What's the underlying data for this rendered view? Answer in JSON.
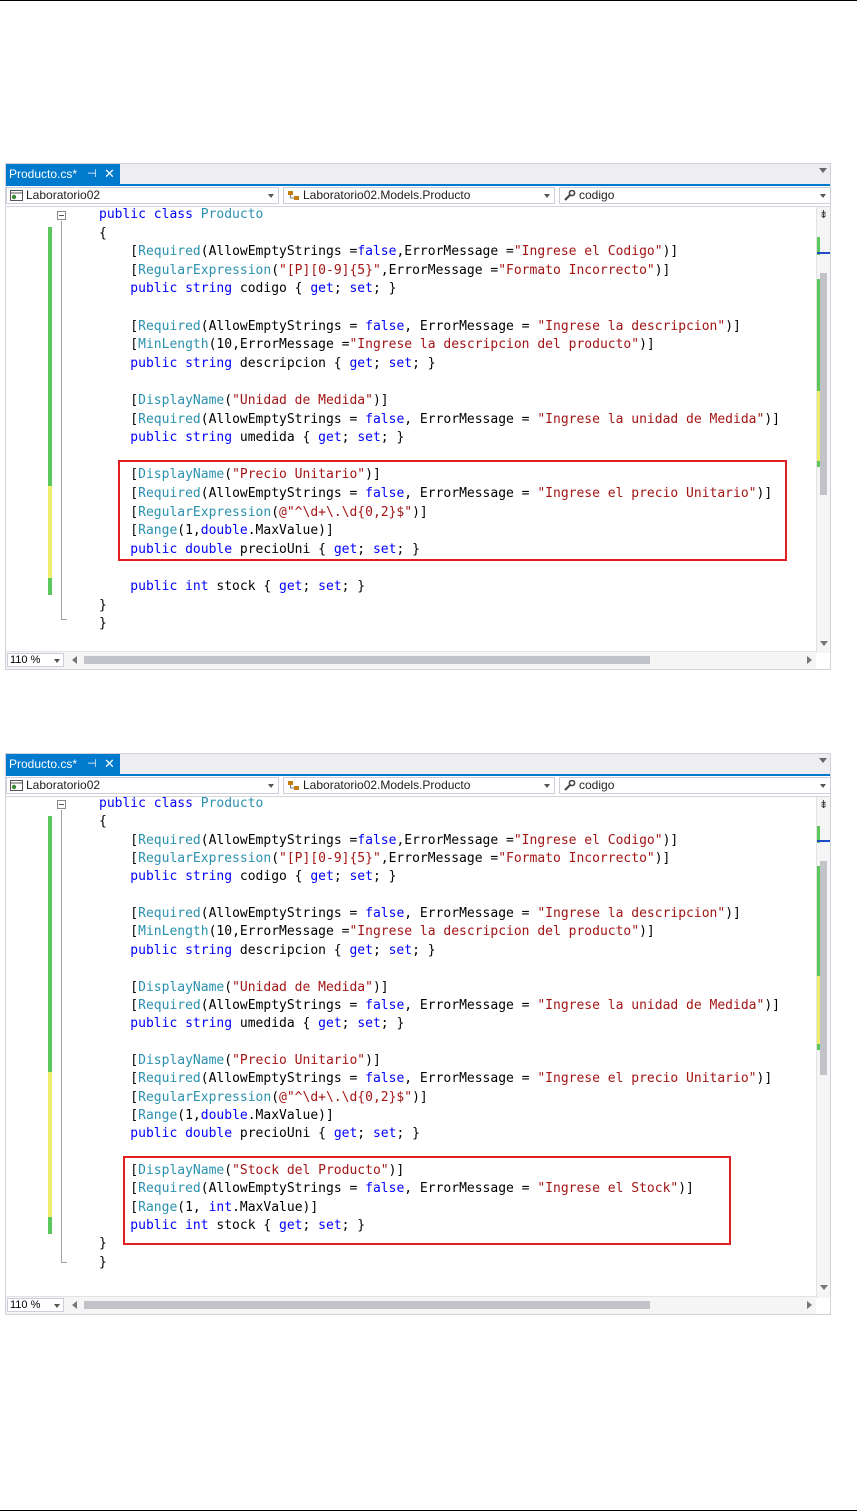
{
  "editors": [
    {
      "tab": {
        "title": "Producto.cs*",
        "pin": "⊣",
        "close": "✕"
      },
      "nav": {
        "project": "Laboratorio02",
        "type": "Laboratorio02.Models.Producto",
        "member": "codigo"
      },
      "zoom": "110 %",
      "lines": [
        [
          [
            "kw",
            "public class "
          ],
          [
            "ty",
            "Producto"
          ]
        ],
        [
          [
            "",
            "{"
          ]
        ],
        [
          [
            "",
            "    ["
          ],
          [
            "ty",
            "Required"
          ],
          [
            "",
            "(AllowEmptyStrings ="
          ],
          [
            "kw",
            "false"
          ],
          [
            "",
            ",ErrorMessage ="
          ],
          [
            "st",
            "\"Ingrese el Codigo\""
          ],
          [
            "",
            ")]"
          ]
        ],
        [
          [
            "",
            "    ["
          ],
          [
            "ty",
            "RegularExpression"
          ],
          [
            "",
            "("
          ],
          [
            "st",
            "\"[P][0-9]{5}\""
          ],
          [
            "",
            ",ErrorMessage ="
          ],
          [
            "st",
            "\"Formato Incorrecto\""
          ],
          [
            "",
            ")]"
          ]
        ],
        [
          [
            "kw",
            "    public string "
          ],
          [
            "",
            "codigo { "
          ],
          [
            "kw",
            "get"
          ],
          [
            "",
            "; "
          ],
          [
            "kw",
            "set"
          ],
          [
            "",
            "; }"
          ]
        ],
        [
          [
            "",
            ""
          ]
        ],
        [
          [
            "",
            "    ["
          ],
          [
            "ty",
            "Required"
          ],
          [
            "",
            "(AllowEmptyStrings = "
          ],
          [
            "kw",
            "false"
          ],
          [
            "",
            ", ErrorMessage = "
          ],
          [
            "st",
            "\"Ingrese la descripcion\""
          ],
          [
            "",
            ")]"
          ]
        ],
        [
          [
            "",
            "    ["
          ],
          [
            "ty",
            "MinLength"
          ],
          [
            "",
            "(10,ErrorMessage ="
          ],
          [
            "st",
            "\"Ingrese la descripcion del producto\""
          ],
          [
            "",
            ")]"
          ]
        ],
        [
          [
            "kw",
            "    public string "
          ],
          [
            "",
            "descripcion { "
          ],
          [
            "kw",
            "get"
          ],
          [
            "",
            "; "
          ],
          [
            "kw",
            "set"
          ],
          [
            "",
            "; }"
          ]
        ],
        [
          [
            "",
            ""
          ]
        ],
        [
          [
            "",
            "    ["
          ],
          [
            "ty",
            "DisplayName"
          ],
          [
            "",
            "("
          ],
          [
            "st",
            "\"Unidad de Medida\""
          ],
          [
            "",
            ")]"
          ]
        ],
        [
          [
            "",
            "    ["
          ],
          [
            "ty",
            "Required"
          ],
          [
            "",
            "(AllowEmptyStrings = "
          ],
          [
            "kw",
            "false"
          ],
          [
            "",
            ", ErrorMessage = "
          ],
          [
            "st",
            "\"Ingrese la unidad de Medida\""
          ],
          [
            "",
            ")]"
          ]
        ],
        [
          [
            "kw",
            "    public string "
          ],
          [
            "",
            "umedida { "
          ],
          [
            "kw",
            "get"
          ],
          [
            "",
            "; "
          ],
          [
            "kw",
            "set"
          ],
          [
            "",
            "; }"
          ]
        ],
        [
          [
            "",
            ""
          ]
        ],
        [
          [
            "",
            "    ["
          ],
          [
            "ty",
            "DisplayName"
          ],
          [
            "",
            "("
          ],
          [
            "st",
            "\"Precio Unitario\""
          ],
          [
            "",
            ")]"
          ]
        ],
        [
          [
            "",
            "    ["
          ],
          [
            "ty",
            "Required"
          ],
          [
            "",
            "(AllowEmptyStrings = "
          ],
          [
            "kw",
            "false"
          ],
          [
            "",
            ", ErrorMessage = "
          ],
          [
            "st",
            "\"Ingrese el precio Unitario\""
          ],
          [
            "",
            ")]"
          ]
        ],
        [
          [
            "",
            "    ["
          ],
          [
            "ty",
            "RegularExpression"
          ],
          [
            "",
            "("
          ],
          [
            "st",
            "@\"^\\d+\\.\\d{0,2}$\""
          ],
          [
            "",
            ")]"
          ]
        ],
        [
          [
            "",
            "    ["
          ],
          [
            "ty",
            "Range"
          ],
          [
            "",
            "(1,"
          ],
          [
            "kw",
            "double"
          ],
          [
            "",
            ".MaxValue)]"
          ]
        ],
        [
          [
            "kw",
            "    public double "
          ],
          [
            "",
            "precioUni { "
          ],
          [
            "kw",
            "get"
          ],
          [
            "",
            "; "
          ],
          [
            "kw",
            "set"
          ],
          [
            "",
            "; }"
          ]
        ],
        [
          [
            "",
            ""
          ]
        ],
        [
          [
            "kw",
            "    public int "
          ],
          [
            "",
            "stock { "
          ],
          [
            "kw",
            "get"
          ],
          [
            "",
            "; "
          ],
          [
            "kw",
            "set"
          ],
          [
            "",
            "; }"
          ]
        ],
        [
          [
            "",
            "}"
          ]
        ],
        [
          [
            "",
            "}"
          ]
        ]
      ]
    },
    {
      "tab": {
        "title": "Producto.cs*",
        "pin": "⊣",
        "close": "✕"
      },
      "nav": {
        "project": "Laboratorio02",
        "type": "Laboratorio02.Models.Producto",
        "member": "codigo"
      },
      "zoom": "110 %",
      "lines": [
        [
          [
            "kw",
            "public class "
          ],
          [
            "ty",
            "Producto"
          ]
        ],
        [
          [
            "",
            "{"
          ]
        ],
        [
          [
            "",
            "    ["
          ],
          [
            "ty",
            "Required"
          ],
          [
            "",
            "(AllowEmptyStrings ="
          ],
          [
            "kw",
            "false"
          ],
          [
            "",
            ",ErrorMessage ="
          ],
          [
            "st",
            "\"Ingrese el Codigo\""
          ],
          [
            "",
            ")]"
          ]
        ],
        [
          [
            "",
            "    ["
          ],
          [
            "ty",
            "RegularExpression"
          ],
          [
            "",
            "("
          ],
          [
            "st",
            "\"[P][0-9]{5}\""
          ],
          [
            "",
            ",ErrorMessage ="
          ],
          [
            "st",
            "\"Formato Incorrecto\""
          ],
          [
            "",
            ")]"
          ]
        ],
        [
          [
            "kw",
            "    public string "
          ],
          [
            "",
            "codigo { "
          ],
          [
            "kw",
            "get"
          ],
          [
            "",
            "; "
          ],
          [
            "kw",
            "set"
          ],
          [
            "",
            "; }"
          ]
        ],
        [
          [
            "",
            ""
          ]
        ],
        [
          [
            "",
            "    ["
          ],
          [
            "ty",
            "Required"
          ],
          [
            "",
            "(AllowEmptyStrings = "
          ],
          [
            "kw",
            "false"
          ],
          [
            "",
            ", ErrorMessage = "
          ],
          [
            "st",
            "\"Ingrese la descripcion\""
          ],
          [
            "",
            ")]"
          ]
        ],
        [
          [
            "",
            "    ["
          ],
          [
            "ty",
            "MinLength"
          ],
          [
            "",
            "(10,ErrorMessage ="
          ],
          [
            "st",
            "\"Ingrese la descripcion del producto\""
          ],
          [
            "",
            ")]"
          ]
        ],
        [
          [
            "kw",
            "    public string "
          ],
          [
            "",
            "descripcion { "
          ],
          [
            "kw",
            "get"
          ],
          [
            "",
            "; "
          ],
          [
            "kw",
            "set"
          ],
          [
            "",
            "; }"
          ]
        ],
        [
          [
            "",
            ""
          ]
        ],
        [
          [
            "",
            "    ["
          ],
          [
            "ty",
            "DisplayName"
          ],
          [
            "",
            "("
          ],
          [
            "st",
            "\"Unidad de Medida\""
          ],
          [
            "",
            ")]"
          ]
        ],
        [
          [
            "",
            "    ["
          ],
          [
            "ty",
            "Required"
          ],
          [
            "",
            "(AllowEmptyStrings = "
          ],
          [
            "kw",
            "false"
          ],
          [
            "",
            ", ErrorMessage = "
          ],
          [
            "st",
            "\"Ingrese la unidad de Medida\""
          ],
          [
            "",
            ")]"
          ]
        ],
        [
          [
            "kw",
            "    public string "
          ],
          [
            "",
            "umedida { "
          ],
          [
            "kw",
            "get"
          ],
          [
            "",
            "; "
          ],
          [
            "kw",
            "set"
          ],
          [
            "",
            "; }"
          ]
        ],
        [
          [
            "",
            ""
          ]
        ],
        [
          [
            "",
            "    ["
          ],
          [
            "ty",
            "DisplayName"
          ],
          [
            "",
            "("
          ],
          [
            "st",
            "\"Precio Unitario\""
          ],
          [
            "",
            ")]"
          ]
        ],
        [
          [
            "",
            "    ["
          ],
          [
            "ty",
            "Required"
          ],
          [
            "",
            "(AllowEmptyStrings = "
          ],
          [
            "kw",
            "false"
          ],
          [
            "",
            ", ErrorMessage = "
          ],
          [
            "st",
            "\"Ingrese el precio Unitario\""
          ],
          [
            "",
            ")]"
          ]
        ],
        [
          [
            "",
            "    ["
          ],
          [
            "ty",
            "RegularExpression"
          ],
          [
            "",
            "("
          ],
          [
            "st",
            "@\"^\\d+\\.\\d{0,2}$\""
          ],
          [
            "",
            ")]"
          ]
        ],
        [
          [
            "",
            "    ["
          ],
          [
            "ty",
            "Range"
          ],
          [
            "",
            "(1,"
          ],
          [
            "kw",
            "double"
          ],
          [
            "",
            ".MaxValue)]"
          ]
        ],
        [
          [
            "kw",
            "    public double "
          ],
          [
            "",
            "precioUni { "
          ],
          [
            "kw",
            "get"
          ],
          [
            "",
            "; "
          ],
          [
            "kw",
            "set"
          ],
          [
            "",
            "; }"
          ]
        ],
        [
          [
            "",
            ""
          ]
        ],
        [
          [
            "",
            "    ["
          ],
          [
            "ty",
            "DisplayName"
          ],
          [
            "",
            "("
          ],
          [
            "st",
            "\"Stock del Producto\""
          ],
          [
            "",
            ")]"
          ]
        ],
        [
          [
            "",
            "    ["
          ],
          [
            "ty",
            "Required"
          ],
          [
            "",
            "(AllowEmptyStrings = "
          ],
          [
            "kw",
            "false"
          ],
          [
            "",
            ", ErrorMessage = "
          ],
          [
            "st",
            "\"Ingrese el Stock\""
          ],
          [
            "",
            ")]"
          ]
        ],
        [
          [
            "",
            "    ["
          ],
          [
            "ty",
            "Range"
          ],
          [
            "",
            "(1, "
          ],
          [
            "kw",
            "int"
          ],
          [
            "",
            ".MaxValue)]"
          ]
        ],
        [
          [
            "kw",
            "    public int "
          ],
          [
            "",
            "stock { "
          ],
          [
            "kw",
            "get"
          ],
          [
            "",
            "; "
          ],
          [
            "kw",
            "set"
          ],
          [
            "",
            "; }"
          ]
        ],
        [
          [
            "",
            "}"
          ]
        ],
        [
          [
            "",
            "}"
          ]
        ]
      ]
    }
  ]
}
